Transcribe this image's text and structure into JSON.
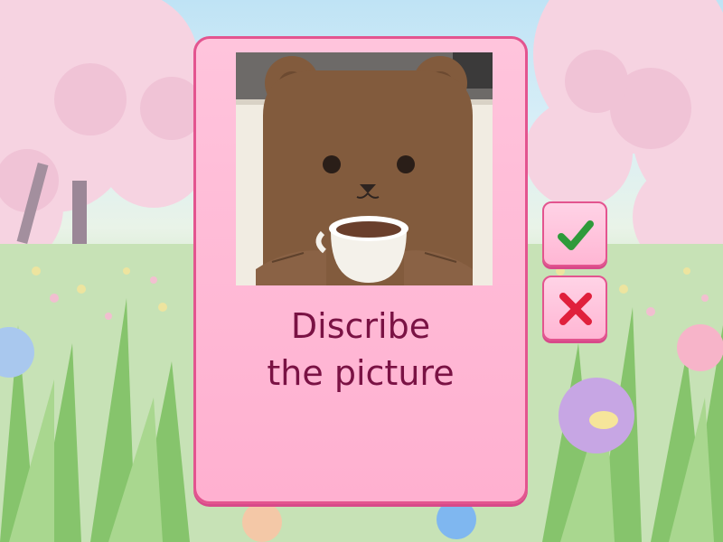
{
  "card": {
    "prompt_line1": "Discribe",
    "prompt_line2": "the picture",
    "picture_subject": "bear-holding-coffee-cup"
  },
  "buttons": {
    "correct_icon": "check-icon",
    "wrong_icon": "close-icon"
  },
  "colors": {
    "card_background": "#ffb0d0",
    "card_border": "#e3548f",
    "text": "#7a1244",
    "check": "#2e9a3a",
    "cross": "#e0203c"
  }
}
